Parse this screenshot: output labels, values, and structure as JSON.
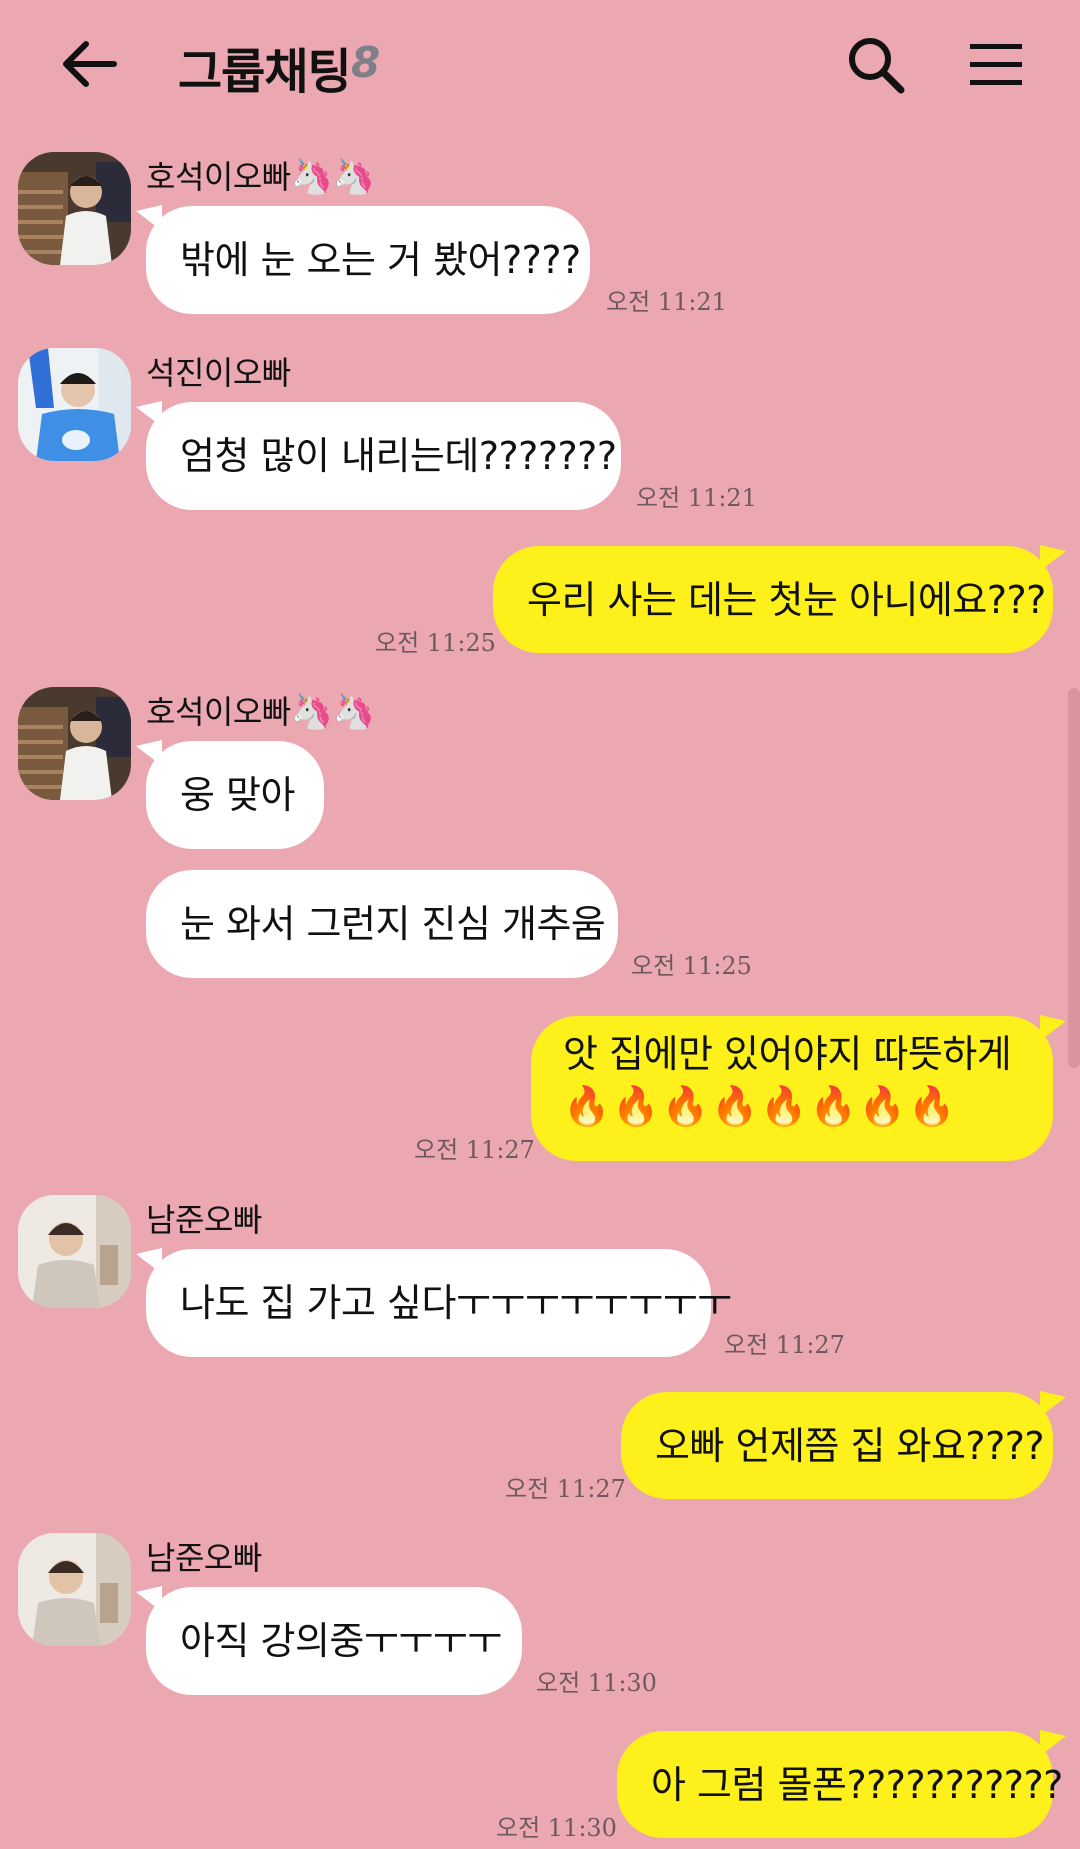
{
  "header": {
    "title": "그룹채팅",
    "member_count": "8",
    "back_icon": "arrow-left-icon",
    "search_icon": "search-icon",
    "menu_icon": "hamburger-menu-icon"
  },
  "colors": {
    "background": "#eba8b1",
    "bubble_received": "#ffffff",
    "bubble_sent": "#fef01b"
  },
  "messages": [
    {
      "sender": "호석이오빠",
      "sender_emoji": "🦄🦄",
      "text": "밖에 눈 오는 거 봤어????",
      "time": "오전 11:21"
    },
    {
      "sender": "석진이오빠",
      "text": "엄청 많이 내리는데???????",
      "time": "오전 11:21"
    },
    {
      "sender": "me",
      "text": "우리 사는 데는 첫눈 아니에요???",
      "time": "오전 11:25"
    },
    {
      "sender": "호석이오빠",
      "sender_emoji": "🦄🦄",
      "text": "웅 맞아"
    },
    {
      "sender": "호석이오빠",
      "text": "눈 와서 그런지 진심 개추움",
      "time": "오전 11:25"
    },
    {
      "sender": "me",
      "text": "앗 집에만 있어야지 따뜻하게",
      "text2": "🔥🔥🔥🔥🔥🔥🔥🔥",
      "time": "오전 11:27"
    },
    {
      "sender": "남준오빠",
      "text": "나도 집 가고 싶다ㅜㅜㅜㅜㅜㅜㅜㅜ",
      "time": "오전 11:27"
    },
    {
      "sender": "me",
      "text": "오빠 언제쯤 집 와요????",
      "time": "오전 11:27"
    },
    {
      "sender": "남준오빠",
      "text": "아직 강의중ㅜㅜㅜㅜ",
      "time": "오전 11:30"
    },
    {
      "sender": "me",
      "text": "아 그럼 몰폰???????????",
      "time": "오전 11:30"
    }
  ]
}
